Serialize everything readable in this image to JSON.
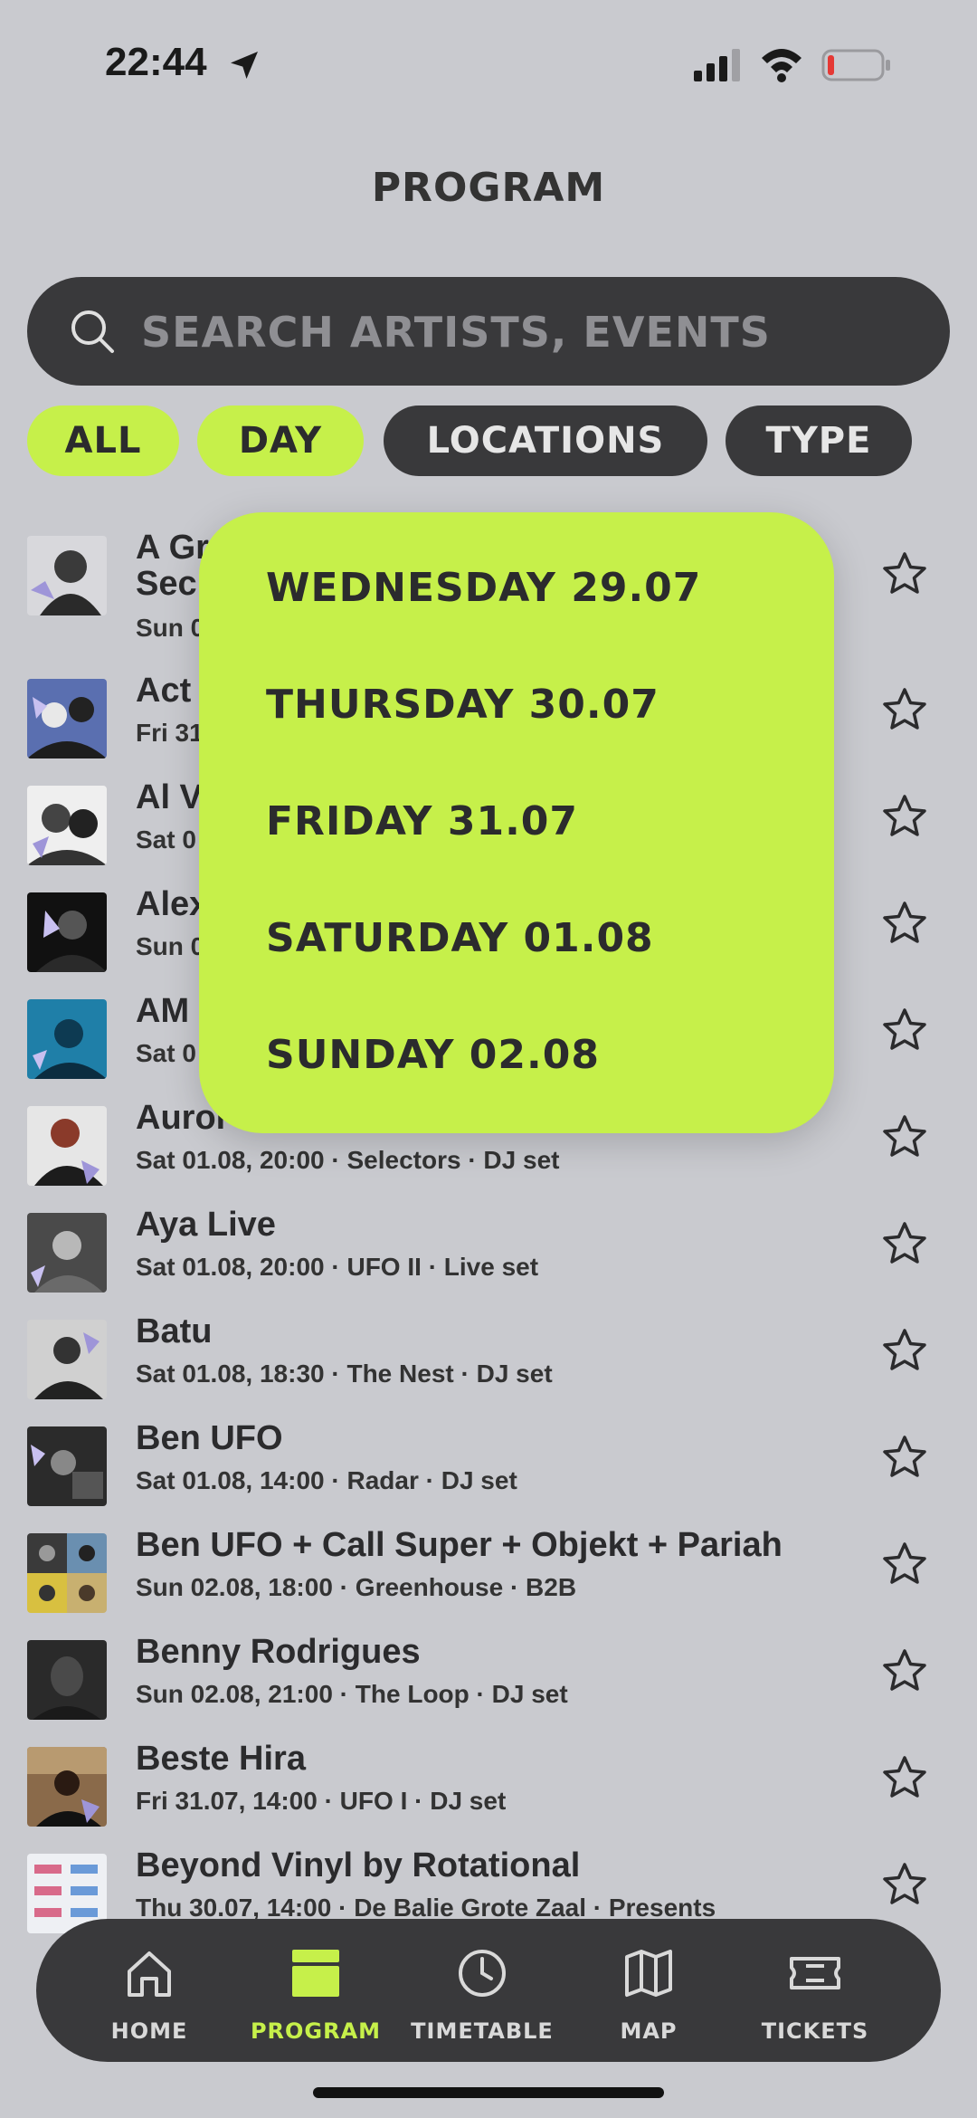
{
  "status": {
    "time": "22:44"
  },
  "header": {
    "title": "PROGRAM"
  },
  "search": {
    "placeholder": "SEARCH ARTISTS, EVENTS"
  },
  "filters": [
    {
      "label": "ALL",
      "active": true
    },
    {
      "label": "DAY",
      "active": true
    },
    {
      "label": "LOCATIONS",
      "active": false
    },
    {
      "label": "TYPE",
      "active": false
    }
  ],
  "list": [
    {
      "title": "A Gr",
      "title2": "Sec",
      "subtitle": "Sun 0"
    },
    {
      "title": "Act",
      "subtitle": "Fri 31"
    },
    {
      "title": "Al V",
      "subtitle": "Sat 0"
    },
    {
      "title": "Alex",
      "subtitle": "Sun 0"
    },
    {
      "title": "AM",
      "subtitle": "Sat 0"
    },
    {
      "title": "Auror",
      "subtitle": "Sat 01.08, 20:00 · Selectors · DJ set"
    },
    {
      "title": "Aya Live",
      "subtitle": "Sat 01.08, 20:00 · UFO II · Live set"
    },
    {
      "title": "Batu",
      "subtitle": "Sat 01.08, 18:30 · The Nest · DJ set"
    },
    {
      "title": "Ben UFO",
      "subtitle": "Sat 01.08, 14:00 · Radar · DJ set"
    },
    {
      "title": "Ben UFO + Call Super + Objekt + Pariah",
      "subtitle": "Sun 02.08, 18:00 · Greenhouse · B2B"
    },
    {
      "title": "Benny Rodrigues",
      "subtitle": "Sun 02.08, 21:00 · The Loop · DJ set"
    },
    {
      "title": "Beste Hira",
      "subtitle": "Fri 31.07, 14:00 · UFO I · DJ set"
    },
    {
      "title": "Beyond Vinyl by Rotational",
      "subtitle": "Thu 30.07, 14:00 · De Balie Grote Zaal · Presents"
    }
  ],
  "day_dropdown": [
    "WEDNESDAY 29.07",
    "THURSDAY 30.07",
    "FRIDAY 31.07",
    "SATURDAY 01.08",
    "SUNDAY 02.08"
  ],
  "tabs": [
    {
      "label": "HOME",
      "icon": "home-icon"
    },
    {
      "label": "PROGRAM",
      "icon": "program-icon",
      "active": true
    },
    {
      "label": "TIMETABLE",
      "icon": "clock-icon"
    },
    {
      "label": "MAP",
      "icon": "map-icon"
    },
    {
      "label": "TICKETS",
      "icon": "ticket-icon"
    }
  ],
  "colors": {
    "accent": "#c6f04a",
    "dark": "#39393b",
    "background": "#c9cacf"
  }
}
